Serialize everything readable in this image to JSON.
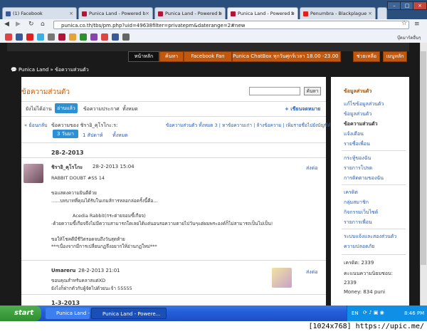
{
  "browser": {
    "tabs": [
      {
        "title": "(1) Facebook",
        "favicon_color": "#3b5998"
      },
      {
        "title": "Punica Land - Powered b",
        "favicon_color": "#b0163a"
      },
      {
        "title": "Punica Land - Powered b",
        "favicon_color": "#b0163a"
      },
      {
        "title": "Punica Land - Powered b",
        "favicon_color": "#b0163a"
      },
      {
        "title": "Penumbra - Blackplague",
        "favicon_color": "#e02020"
      }
    ],
    "url": "punica.co.th/tbs/pm.php?uid=49638filter=privatepm&daterange=2#new",
    "bookmarks_label": "บุ๊คมาร์คอื่นๆ"
  },
  "site": {
    "nav": [
      "หน้าหลัก",
      "ค้นหา",
      "Facebook Fan",
      "Punica ChatBox ทุกวันศุกร์เวลา 18.00 -23.00 น.",
      "ช่วยเหลือ",
      "เมนูหลัก"
    ],
    "breadcrumb": "Punica Land » ข้อความส่วนตัว"
  },
  "main": {
    "title": "ข้อความส่วนตัว",
    "search_button": "ค้นหา",
    "filters": {
      "unread": "ยังไม่ได้อ่าน",
      "read": "อ่านแล้ว",
      "sent": "ข้อความประกาศ",
      "all": "ทั้งหมด",
      "new_pm": "+ เขียนจดหมาย"
    },
    "thread_bar": {
      "back": "« ย้อนกลับ",
      "subject": "ข้อความของ ชิราอิ_คุโรโกะ:ร:",
      "actions": "ข้อความส่วนตัว ทั้งหมด 3 | หาข้อความเก่า | ล้างข้อความ | เพิ่มรายชื่อไปยังบัญชีดำ",
      "pages": "3 วันมาแล้ว",
      "page1": "1 สัปดาห์",
      "page_all": "ทั้งหมด"
    },
    "groups": [
      {
        "date": "28-2-2013",
        "posts": [
          {
            "author": "ชิราอิ_คุโรโกะ",
            "time": "28-2-2013 15:04",
            "reply": "ส่งต่อ",
            "lines": [
              "RABBIT  DOUBT #SS 14",
              "",
              "ขอแสดงความยินดีด้วย",
              "......บทบาทที่คุณได้รับในเกมส์การหลอกล่อครั้งนี้คือ...",
              "",
              "Acedia Rabbit(กระต่ายจอมขี้เกียจ)",
              "-ด้วยความขี้เกียจจึงไม่มีความสามารถใดเลยได้แต่นอนรอความตายไปวันๆแต่ผมพระองค์ก็ไม่สามารถเป็นไม่เป็น!",
              "",
              "ขอให้โชคดีมีชีวิตรอดจนถึงวันสุดท้าย",
              "***เนื่องจากมีการเปลี่ยนกฏจึงอยากให้อ่านกฏใหม่***"
            ]
          },
          {
            "author": "Umareru",
            "time": "28-2-2013 21:01",
            "reply": "ส่งต่อ",
            "lines": [
              "ขอบคุณสำหรับคลาสแต่XD",
              "ยังไงก็ฝากตัวกับผู้จัดไปด้วยนะจ้า 55555"
            ]
          }
        ]
      },
      {
        "date": "1-3-2013",
        "posts": []
      }
    ]
  },
  "sidebar": {
    "heading": "ข้อมูลส่วนตัว",
    "links": [
      "แก้ไขข้อมูลส่วนตัว",
      "ข้อมูลส่วนตัว",
      "ข้อความส่วนตัว",
      "แจ้งเตือน",
      "รายชื่อเพื่อน",
      "กระทู้ของฉัน",
      "รายการโปรด",
      "การติดตามของฉัน",
      "เครดิต",
      "กลุ่มสมาชิก",
      "กิจกรรมเว็บไซต์",
      "รายการเพื่อน",
      "ระบบแจ้งและสองส่วนตัว",
      "ความปลอดภัย"
    ],
    "stats": [
      "เครดิต: 2339",
      "คะแนนความนิยมชอบ: 2339",
      "Money: 834 puni"
    ]
  },
  "taskbar": {
    "start": "start",
    "items": [
      "Punica Land - Powere...",
      "Punica Land - Powere..."
    ],
    "lang": "EN",
    "clock": "8:46 PM"
  },
  "caption": "[1024x768] https://upic.me/"
}
